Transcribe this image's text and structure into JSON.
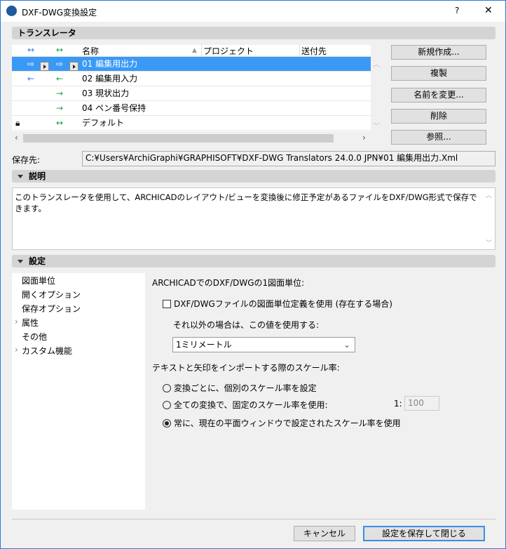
{
  "window": {
    "title": "DXF-DWG変換設定",
    "help": "?",
    "close": "✕"
  },
  "translator": {
    "section": "トランスレータ",
    "columns": {
      "in": "↔",
      "out": "↔",
      "name": "名称",
      "project": "プロジェクト",
      "dest": "送付先"
    },
    "rows": [
      {
        "in": "⇨",
        "out": "⇨",
        "name": "01 編集用出力",
        "selected": true
      },
      {
        "in": "←",
        "out": "←",
        "name": "02 編集用入力"
      },
      {
        "in": "",
        "out": "→",
        "name": "03 現状出力"
      },
      {
        "in": "",
        "out": "→",
        "name": "04 ペン番号保持"
      },
      {
        "in": "",
        "out": "↔",
        "name": "デフォルト",
        "locked": true
      }
    ],
    "buttons": [
      "新規作成...",
      "複製",
      "名前を変更...",
      "削除",
      "参照..."
    ]
  },
  "save": {
    "label": "保存先:",
    "path": "C:¥Users¥ArchiGraphi¥GRAPHISOFT¥DXF-DWG Translators 24.0.0 JPN¥01 編集用出力.Xml"
  },
  "description": {
    "section": "説明",
    "text": "このトランスレータを使用して、ARCHICADのレイアウト/ビューを変換後に修正予定があるファイルをDXF/DWG形式で保存できます。"
  },
  "settings": {
    "section": "設定",
    "nav": [
      {
        "label": "図面単位"
      },
      {
        "label": "開くオプション"
      },
      {
        "label": "保存オプション"
      },
      {
        "label": "属性",
        "expand": "›"
      },
      {
        "label": "その他"
      },
      {
        "label": "カスタム機能",
        "expand": "›"
      }
    ],
    "unit_heading": "ARCHICADでのDXF/DWGの1図面単位:",
    "use_file_unit": "DXF/DWGファイルの図面単位定義を使用 (存在する場合)",
    "otherwise": "それ以外の場合は、この値を使用する:",
    "unit_value": "1ミリメートル",
    "scale_heading": "テキストと矢印をインポートする際のスケール率:",
    "radios": [
      {
        "label": "変換ごとに、個別のスケール率を設定",
        "checked": false
      },
      {
        "label": "全ての変換で、固定のスケール率を使用:",
        "checked": false
      },
      {
        "label": "常に、現在の平面ウィンドウで設定されたスケール率を使用",
        "checked": true
      }
    ],
    "scale_prefix": "1:",
    "scale_value": "100"
  },
  "footer": {
    "cancel": "キャンセル",
    "save": "設定を保存して閉じる"
  }
}
